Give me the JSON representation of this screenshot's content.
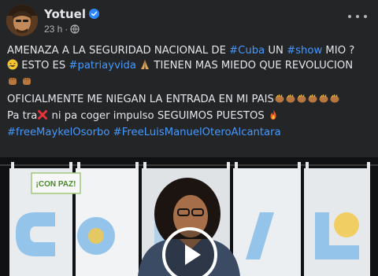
{
  "post": {
    "author": "Yotuel",
    "timestamp": "23 h",
    "separator": "·",
    "lines": {
      "l1a": "AMENAZA A LA SEGURIDAD NACIONAL DE ",
      "l1b": "#Cuba",
      "l1c": " UN ",
      "l1d": "#show",
      "l1e": "  MIO ?",
      "l2a": " ESTO ES  ",
      "l2b": "#patriayvida",
      "l2c": " TIENEN MAS MIEDO QUE REVOLUCION",
      "l4a": "OFICIALMENTE ME NIEGAN LA ENTRADA EN MI PAIS",
      "l5a": "Pa tra",
      "l5b": " ni pa coger impulso SEGUIMOS PUESTOS ",
      "l6a": "#freeMaykelOsorbo",
      "l6b": " ",
      "l6c": "#FreeLuisManuelOteroAlcantara"
    },
    "video_panel_texts": {
      "sign": "¡CON PAZ!",
      "big_word": "CONMIGO"
    }
  },
  "colors": {
    "background": "#242526",
    "text": "#e4e6eb",
    "secondary": "#b0b3b8",
    "hashtag": "#4599ff",
    "verified": "#2d88ff"
  },
  "icons": {
    "verified": "verified-badge-icon",
    "privacy": "globe-icon",
    "more": "more-options-icon",
    "play": "play-icon"
  }
}
